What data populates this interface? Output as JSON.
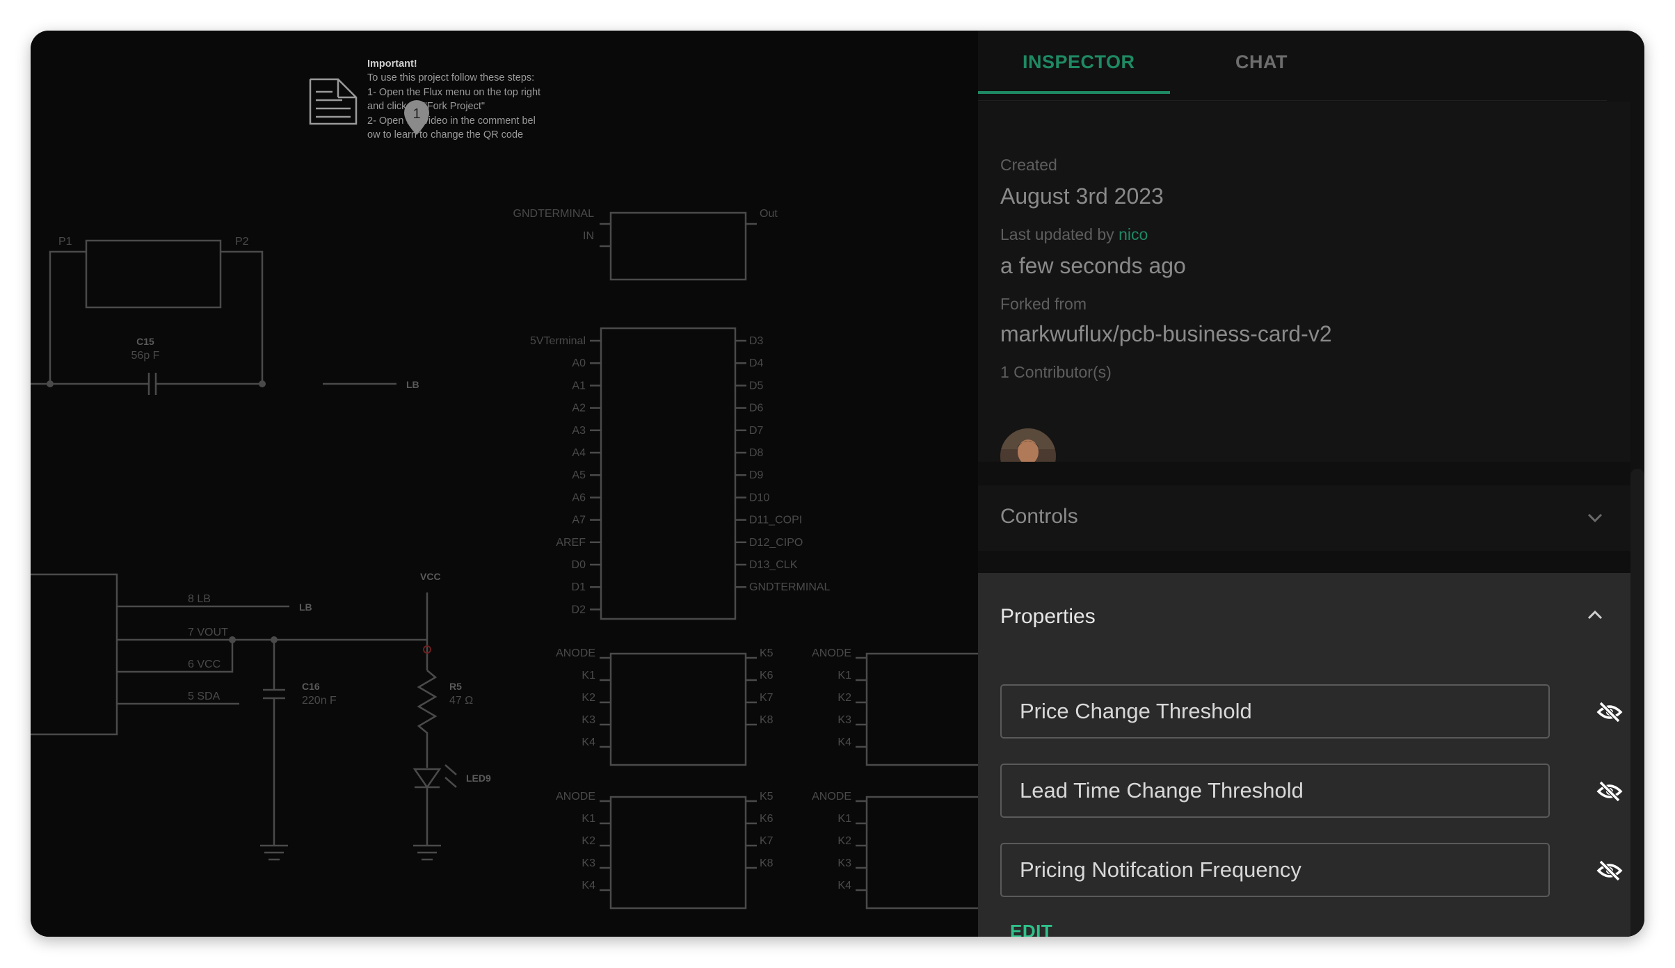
{
  "tabs": [
    {
      "label": "INSPECTOR",
      "active": true
    },
    {
      "label": "CHAT",
      "active": false
    }
  ],
  "meta": {
    "created_label": "Created",
    "created_value": "August 3rd 2023",
    "updated_label": "Last updated by",
    "updated_user": "nico",
    "updated_value": "a few seconds ago",
    "forked_label": "Forked from",
    "forked_value": "markwuflux/pcb-business-card-v2",
    "contributors_label": "1 Contributor(s)"
  },
  "controls": {
    "title": "Controls",
    "expanded": false
  },
  "properties": {
    "title": "Properties",
    "expanded": true,
    "fields": [
      {
        "label": "Price Change Threshold",
        "icon": "eye-off-icon"
      },
      {
        "label": "Lead Time Change Threshold",
        "icon": "eye-off-icon"
      },
      {
        "label": "Pricing Notifcation Frequency",
        "icon": "eye-off-icon"
      }
    ],
    "edit_label": "EDIT"
  },
  "note": {
    "heading": "Important!",
    "lines": [
      "To use this project follow these steps:",
      "1- Open the Flux menu on the top right",
      "and click on \"Fork Project\"",
      "2- Open the video in the comment bel",
      "ow to learn to change the QR code"
    ],
    "comment_count": "1"
  },
  "schematic": {
    "top_part": {
      "left_pins": [
        "GNDTERMINAL",
        "IN"
      ],
      "right_pins": [
        "Out"
      ]
    },
    "mcu": {
      "left_pins": [
        "5VTerminal",
        "A0",
        "A1",
        "A2",
        "A3",
        "A4",
        "A5",
        "A6",
        "A7",
        "AREF",
        "D0",
        "D1",
        "D2"
      ],
      "right_pins": [
        "D3",
        "D4",
        "D5",
        "D6",
        "D7",
        "D8",
        "D9",
        "D10",
        "D11_COPI",
        "D12_CIPO",
        "D13_CLK",
        "GNDTERMINAL"
      ]
    },
    "display_left_pins": [
      "ANODE",
      "K1",
      "K2",
      "K3",
      "K4"
    ],
    "display_right_pins": [
      "K5",
      "K6",
      "K7",
      "K8"
    ],
    "crystal": {
      "p1": "P1",
      "p2": "P2"
    },
    "c15": {
      "name": "C15",
      "value": "56p F"
    },
    "c16": {
      "name": "C16",
      "value": "220n F"
    },
    "r5": {
      "name": "R5",
      "value": "47 Ω"
    },
    "led": {
      "name": "LED9"
    },
    "vcc": "VCC",
    "net_lb": "LB",
    "header_pins": [
      "8  LB",
      "7  VOUT",
      "6  VCC",
      "5  SDA"
    ]
  },
  "colors": {
    "accent": "#1e8a63",
    "edit": "#2ec28a",
    "schematic_line": "#4a4a4a"
  }
}
